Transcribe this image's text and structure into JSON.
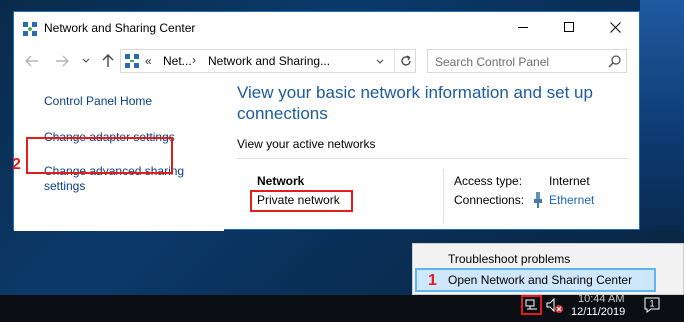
{
  "window": {
    "title": "Network and Sharing Center"
  },
  "address": {
    "overflow": "«",
    "segment1": "Net...",
    "separator": "›",
    "segment2": "Network and Sharing...",
    "search_placeholder": "Search Control Panel"
  },
  "sidebar": {
    "home": "Control Panel Home",
    "adapter": "Change adapter settings",
    "advanced": "Change advanced sharing settings",
    "step_number": "2"
  },
  "main": {
    "title": "View your basic network information and set up connections",
    "section_label": "View your active networks",
    "network_name": "Network",
    "network_type": "Private network",
    "access_type_label": "Access type:",
    "access_type_value": "Internet",
    "connections_label": "Connections:",
    "connections_value": "Ethernet"
  },
  "tray_menu": {
    "items": [
      "Troubleshoot problems",
      "Open Network and Sharing Center"
    ],
    "step_number": "1"
  },
  "taskbar": {
    "time": "10:44 AM",
    "date": "12/11/2019",
    "notification_count": "1"
  },
  "colors": {
    "link": "#0b3f82",
    "title_blue": "#1d5a9c",
    "highlight_red": "#e11d1d",
    "menu_highlight": "#cfe7fb"
  }
}
